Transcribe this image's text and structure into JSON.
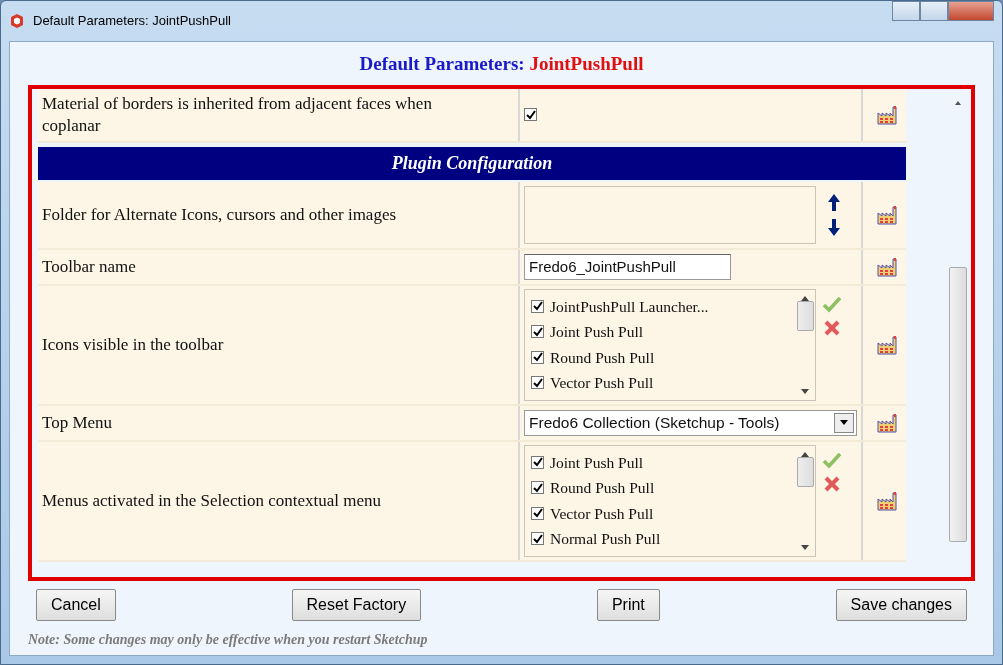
{
  "window": {
    "title": "Default Parameters: JointPushPull"
  },
  "heading": {
    "label": "Default Parameters:",
    "name": "JointPushPull"
  },
  "parameters": [
    {
      "kind": "checkbox",
      "label": "Material of borders is inherited from adjacent faces when coplanar",
      "checked": true
    },
    {
      "kind": "section",
      "label": "Plugin Configuration"
    },
    {
      "kind": "folder",
      "label": "Folder for Alternate Icons, cursors and other images"
    },
    {
      "kind": "text",
      "label": "Toolbar name",
      "value": "Fredo6_JointPushPull"
    },
    {
      "kind": "checklist",
      "label": "Icons visible in the toolbar",
      "items": [
        {
          "label": "JointPushPull Launcher...",
          "checked": true
        },
        {
          "label": "Joint Push Pull",
          "checked": true
        },
        {
          "label": "Round Push Pull",
          "checked": true
        },
        {
          "label": "Vector Push Pull",
          "checked": true
        }
      ]
    },
    {
      "kind": "select",
      "label": "Top Menu",
      "value": "Fredo6 Collection (Sketchup - Tools)"
    },
    {
      "kind": "checklist",
      "label": "Menus activated in the Selection contextual menu",
      "items": [
        {
          "label": "Joint Push Pull",
          "checked": true
        },
        {
          "label": "Round Push Pull",
          "checked": true
        },
        {
          "label": "Vector Push Pull",
          "checked": true
        },
        {
          "label": "Normal Push Pull",
          "checked": true
        }
      ]
    }
  ],
  "buttons": [
    "Cancel",
    "Reset Factory",
    "Print",
    "Save changes"
  ],
  "note": "Note: Some changes may only be effective when you restart Sketchup"
}
